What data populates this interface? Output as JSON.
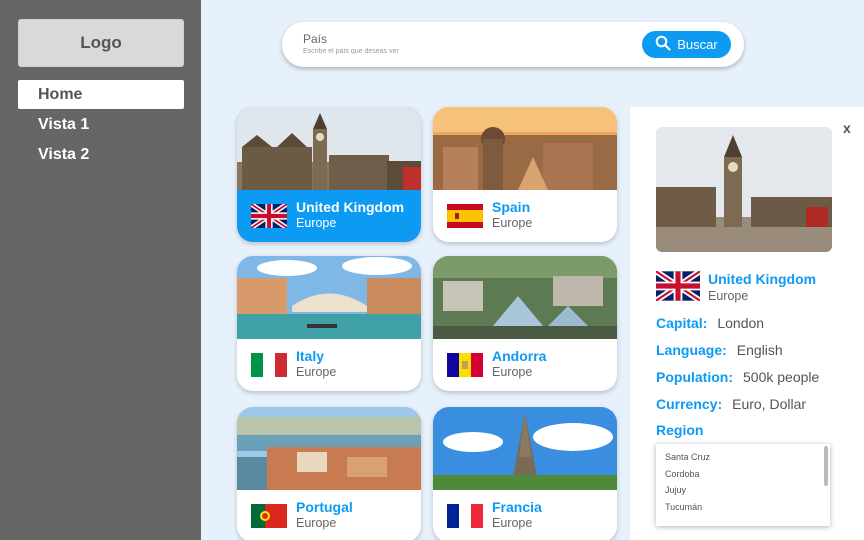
{
  "sidebar": {
    "logo": "Logo",
    "items": [
      {
        "label": "Home",
        "active": true
      },
      {
        "label": "Vista 1",
        "active": false
      },
      {
        "label": "Vista 2",
        "active": false
      }
    ]
  },
  "search": {
    "label": "País",
    "placeholder": "Escribe el país que deseas ver",
    "button": "Buscar"
  },
  "countries": [
    {
      "name": "United Kingdom",
      "region": "Europe",
      "selected": true,
      "flag": "uk-flag-icon"
    },
    {
      "name": "Spain",
      "region": "Europe",
      "selected": false,
      "flag": "spain-flag-icon"
    },
    {
      "name": "Italy",
      "region": "Europe",
      "selected": false,
      "flag": "italy-flag-icon"
    },
    {
      "name": "Andorra",
      "region": "Europe",
      "selected": false,
      "flag": "andorra-flag-icon"
    },
    {
      "name": "Portugal",
      "region": "Europe",
      "selected": false,
      "flag": "portugal-flag-icon"
    },
    {
      "name": "Francia",
      "region": "Europe",
      "selected": false,
      "flag": "france-flag-icon"
    }
  ],
  "detail": {
    "close": "x",
    "name": "United Kingdom",
    "region": "Europe",
    "capital_label": "Capital:",
    "capital": "London",
    "language_label": "Language:",
    "language": "English",
    "population_label": "Population:",
    "population": "500k people",
    "currency_label": "Currency:",
    "currency": "Euro, Dollar",
    "region_label": "Region",
    "regions": [
      "Santa Cruz",
      "Cordoba",
      "Jujuy",
      "Tucumán"
    ]
  },
  "colors": {
    "accent": "#0d9af2",
    "sidebar": "#666666",
    "background": "#e6f1fb"
  }
}
